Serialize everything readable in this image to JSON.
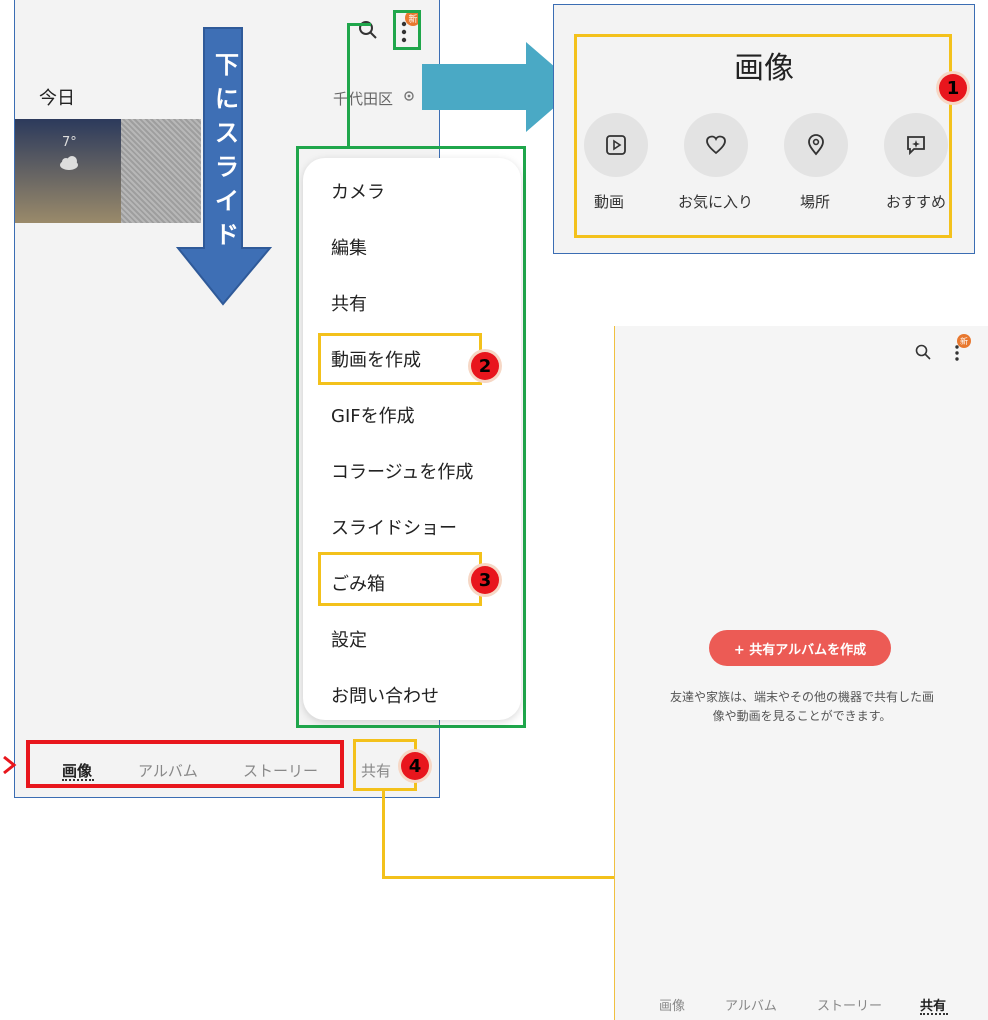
{
  "left_screen": {
    "section_today": "今日",
    "location": "千代田区",
    "weather_temp": "7°",
    "slide_instruction": "下にスライド",
    "nav": [
      {
        "label": "画像",
        "active": true
      },
      {
        "label": "アルバム",
        "active": false
      },
      {
        "label": "ストーリー",
        "active": false
      },
      {
        "label": "共有",
        "active": false
      }
    ],
    "new_badge": "新"
  },
  "menu": {
    "items": [
      "カメラ",
      "編集",
      "共有",
      "動画を作成",
      "GIFを作成",
      "コラージュを作成",
      "スライドショー",
      "ごみ箱",
      "設定",
      "お問い合わせ"
    ]
  },
  "top_panel": {
    "title": "画像",
    "categories": [
      {
        "label": "動画",
        "icon": "play-square-icon"
      },
      {
        "label": "お気に入り",
        "icon": "heart-icon"
      },
      {
        "label": "場所",
        "icon": "location-pin-icon"
      },
      {
        "label": "おすすめ",
        "icon": "sparkle-chat-icon"
      }
    ]
  },
  "right_screen": {
    "new_badge": "新",
    "create_button": "+ 共有アルバムを作成",
    "description_line1": "友達や家族は、端末やその他の機器で共有した画",
    "description_line2": "像や動画を見ることができます。",
    "nav": [
      {
        "label": "画像",
        "active": false
      },
      {
        "label": "アルバム",
        "active": false
      },
      {
        "label": "ストーリー",
        "active": false
      },
      {
        "label": "共有",
        "active": true
      }
    ]
  },
  "callouts": [
    "1",
    "2",
    "3",
    "4"
  ],
  "colors": {
    "accent_red": "#e8161d",
    "callout_yellow": "#f3c11b",
    "callout_green": "#1fa64b",
    "arrow_blue": "#4aa9c5",
    "slide_blue": "#3e6fb5",
    "create_button": "#ec5b55"
  }
}
